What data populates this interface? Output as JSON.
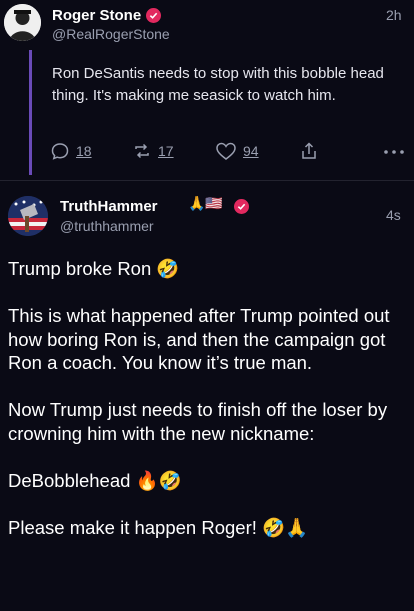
{
  "reply_post": {
    "author_name": "Roger Stone",
    "handle": "@RealRogerStone",
    "time": "2h",
    "text": "Ron DeSantis needs to stop with this bobble head thing. It's making me seasick to watch him.",
    "replies": "18",
    "retruths": "17",
    "likes": "94"
  },
  "main_post": {
    "author_name": "TruthHammer",
    "name_emojis": "🙏🇺🇸",
    "handle": "@truthhammer",
    "time": "4s",
    "paragraphs": [
      "Trump broke Ron 🤣",
      "This is what happened after Trump pointed out how boring Ron is, and then the campaign got Ron a coach. You know it’s true man.",
      "Now Trump just needs to finish off the loser by crowning him with the new nickname:",
      "DeBobblehead 🔥🤣",
      "Please make it happen Roger! 🤣🙏"
    ]
  },
  "colors": {
    "background": "#0a0a15",
    "verified_badge": "#e2295f",
    "thread_line": "#6a4bb8",
    "muted_text": "#9a9fb0"
  }
}
